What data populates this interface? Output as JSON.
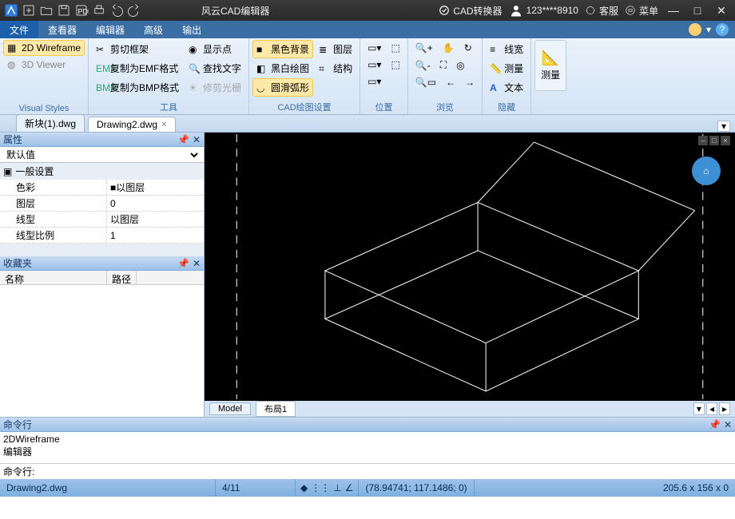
{
  "titlebar": {
    "app_title": "风云CAD编辑器",
    "converter": "CAD转换器",
    "user": "123****8910",
    "support": "客服",
    "menu": "菜单"
  },
  "menubar": {
    "tabs": [
      "文件",
      "查看器",
      "编辑器",
      "高级",
      "输出"
    ]
  },
  "ribbon": {
    "visual_styles": {
      "wireframe2d": "2D Wireframe",
      "viewer3d": "3D Viewer",
      "label": "Visual Styles"
    },
    "tools": {
      "crop_frame": "剪切框架",
      "copy_emf": "复制为EMF格式",
      "copy_bmp": "复制为BMP格式",
      "show_point": "显示点",
      "find_text": "查找文字",
      "trim_ray": "修剪光栅",
      "label": "工具"
    },
    "cad_settings": {
      "black_bg": "黑色背景",
      "bw_drawing": "黑白绘图",
      "smooth_arc": "圆滑弧形",
      "layers": "图层",
      "structure": "结构",
      "label": "CAD绘图设置"
    },
    "position": {
      "label": "位置"
    },
    "preview": {
      "label": "浏览"
    },
    "hide": {
      "linewidth": "线宽",
      "measure": "测量",
      "text": "文本",
      "label": "隐藏"
    },
    "measure_big": "测量"
  },
  "doctabs": {
    "tab1": "新块(1).dwg",
    "tab2": "Drawing2.dwg"
  },
  "panels": {
    "properties": {
      "title": "属性",
      "default_label": "默认值",
      "category": "一般设置",
      "rows": {
        "color_k": "色彩",
        "color_v": "以图层",
        "layer_k": "图层",
        "layer_v": "0",
        "linetype_k": "线型",
        "linetype_v": "以图层",
        "linescale_k": "线型比例",
        "linescale_v": "1"
      }
    },
    "favorites": {
      "title": "收藏夹",
      "col_name": "名称",
      "col_path": "路径"
    }
  },
  "model_tabs": {
    "model": "Model",
    "layout1": "布局1"
  },
  "command": {
    "title": "命令行",
    "hist1": "2DWireframe",
    "hist2": "编辑器",
    "prompt": "命令行:"
  },
  "status": {
    "file": "Drawing2.dwg",
    "counter": "4/11",
    "coords": "(78.94741; 117.1486; 0)",
    "dims": "205.6 x 156 x 0"
  }
}
